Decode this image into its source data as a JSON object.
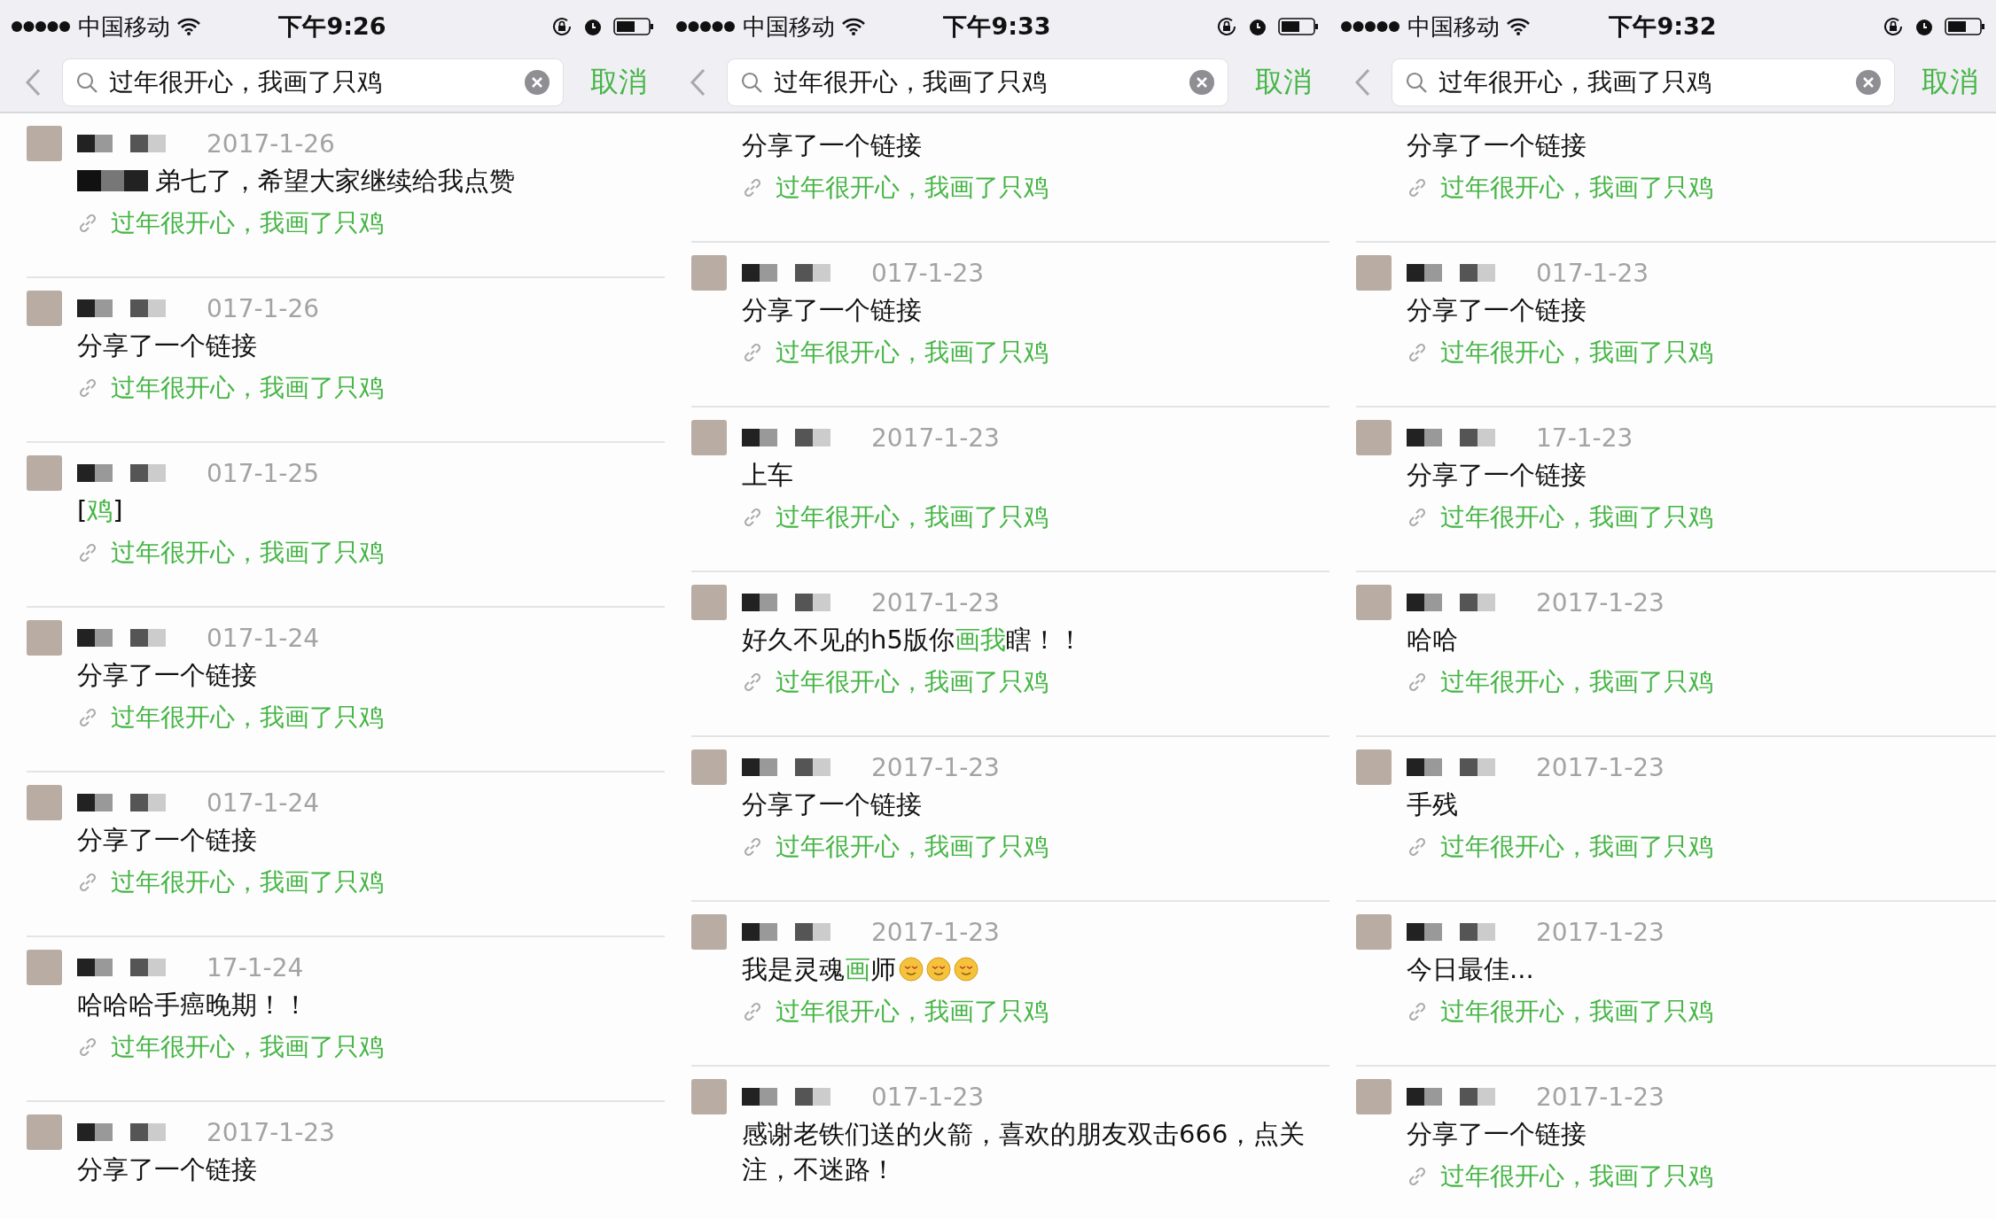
{
  "panels": [
    {
      "status_bar": {
        "carrier": "中国移动",
        "time": "下午9:26"
      },
      "search": {
        "value": "过年很开心，我画了只鸡"
      },
      "cancel": "取消",
      "results": [
        {
          "kind": "full",
          "date": "2017-1-26",
          "message": [
            {
              "kind": "redaction"
            },
            {
              "kind": "text",
              "text": "弟七了，希望大家继续给我点赞",
              "highlight": false
            }
          ],
          "link": "过年很开心，我画了只鸡"
        },
        {
          "kind": "full",
          "date": "017-1-26",
          "message": [
            {
              "kind": "text",
              "text": "分享了一个链接",
              "highlight": false
            }
          ],
          "link": "过年很开心，我画了只鸡"
        },
        {
          "kind": "full",
          "date": "017-1-25",
          "message": [
            {
              "kind": "text",
              "text": "[",
              "highlight": false
            },
            {
              "kind": "text",
              "text": "鸡",
              "highlight": true
            },
            {
              "kind": "text",
              "text": "]",
              "highlight": false
            }
          ],
          "link": "过年很开心，我画了只鸡"
        },
        {
          "kind": "full",
          "date": "017-1-24",
          "message": [
            {
              "kind": "text",
              "text": "分享了一个链接",
              "highlight": false
            }
          ],
          "link": "过年很开心，我画了只鸡"
        },
        {
          "kind": "full",
          "date": "017-1-24",
          "message": [
            {
              "kind": "text",
              "text": "分享了一个链接",
              "highlight": false
            }
          ],
          "link": "过年很开心，我画了只鸡"
        },
        {
          "kind": "full",
          "date": "17-1-24",
          "message": [
            {
              "kind": "text",
              "text": "哈哈哈手癌晚期！！",
              "highlight": false
            }
          ],
          "link": "过年很开心，我画了只鸡"
        },
        {
          "kind": "full",
          "date": "2017-1-23",
          "message": [
            {
              "kind": "text",
              "text": "分享了一个链接",
              "highlight": false
            }
          ]
        }
      ]
    },
    {
      "status_bar": {
        "carrier": "中国移动",
        "time": "下午9:33"
      },
      "search": {
        "value": "过年很开心，我画了只鸡"
      },
      "cancel": "取消",
      "results": [
        {
          "kind": "continued",
          "message": [
            {
              "kind": "text",
              "text": "分享了一个链接",
              "highlight": false
            }
          ],
          "link": "过年很开心，我画了只鸡"
        },
        {
          "kind": "full",
          "date": "017-1-23",
          "message": [
            {
              "kind": "text",
              "text": "分享了一个链接",
              "highlight": false
            }
          ],
          "link": "过年很开心，我画了只鸡"
        },
        {
          "kind": "full",
          "date": "2017-1-23",
          "message": [
            {
              "kind": "text",
              "text": "上车",
              "highlight": false
            }
          ],
          "link": "过年很开心，我画了只鸡"
        },
        {
          "kind": "full",
          "date": "2017-1-23",
          "message": [
            {
              "kind": "text",
              "text": "好久不见的h5版你",
              "highlight": false
            },
            {
              "kind": "text",
              "text": "画我",
              "highlight": true
            },
            {
              "kind": "text",
              "text": "瞎！！",
              "highlight": false
            }
          ],
          "link": "过年很开心，我画了只鸡"
        },
        {
          "kind": "full",
          "date": "2017-1-23",
          "message": [
            {
              "kind": "text",
              "text": "分享了一个链接",
              "highlight": false
            }
          ],
          "link": "过年很开心，我画了只鸡"
        },
        {
          "kind": "full",
          "date": "2017-1-23",
          "message": [
            {
              "kind": "text",
              "text": "我是灵魂",
              "highlight": false
            },
            {
              "kind": "text",
              "text": "画",
              "highlight": true
            },
            {
              "kind": "text",
              "text": "师",
              "highlight": false
            },
            {
              "kind": "emoji"
            },
            {
              "kind": "emoji"
            },
            {
              "kind": "emoji"
            }
          ],
          "link": "过年很开心，我画了只鸡"
        },
        {
          "kind": "full",
          "date": "017-1-23",
          "message": [
            {
              "kind": "text",
              "text": "感谢老铁们送的火箭，喜欢的朋友双击666，点关注，不迷路！",
              "highlight": false
            }
          ]
        }
      ]
    },
    {
      "status_bar": {
        "carrier": "中国移动",
        "time": "下午9:32"
      },
      "search": {
        "value": "过年很开心，我画了只鸡"
      },
      "cancel": "取消",
      "results": [
        {
          "kind": "continued",
          "message": [
            {
              "kind": "text",
              "text": "分享了一个链接",
              "highlight": false
            }
          ],
          "link": "过年很开心，我画了只鸡"
        },
        {
          "kind": "full",
          "date": "017-1-23",
          "message": [
            {
              "kind": "text",
              "text": "分享了一个链接",
              "highlight": false
            }
          ],
          "link": "过年很开心，我画了只鸡"
        },
        {
          "kind": "full",
          "date": "17-1-23",
          "message": [
            {
              "kind": "text",
              "text": "分享了一个链接",
              "highlight": false
            }
          ],
          "link": "过年很开心，我画了只鸡"
        },
        {
          "kind": "full",
          "date": "2017-1-23",
          "message": [
            {
              "kind": "text",
              "text": "哈哈",
              "highlight": false
            }
          ],
          "link": "过年很开心，我画了只鸡"
        },
        {
          "kind": "full",
          "date": "2017-1-23",
          "message": [
            {
              "kind": "text",
              "text": "手残",
              "highlight": false
            }
          ],
          "link": "过年很开心，我画了只鸡"
        },
        {
          "kind": "full",
          "date": "2017-1-23",
          "message": [
            {
              "kind": "text",
              "text": "今日最佳...",
              "highlight": false
            }
          ],
          "link": "过年很开心，我画了只鸡"
        },
        {
          "kind": "full",
          "date": "2017-1-23",
          "message": [
            {
              "kind": "text",
              "text": "分享了一个链接",
              "highlight": false
            }
          ],
          "link": "过年很开心，我画了只鸡"
        }
      ]
    }
  ]
}
